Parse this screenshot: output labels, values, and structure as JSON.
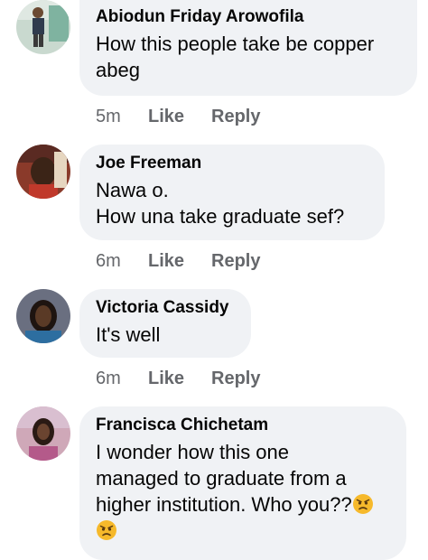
{
  "comments": [
    {
      "author": "Abiodun Friday Arowofila",
      "text": "How this people take be copper\nabeg",
      "time": "5m",
      "like_label": "Like",
      "reply_label": "Reply"
    },
    {
      "author": "Joe Freeman",
      "text": "Nawa o.\nHow una take graduate sef?",
      "time": "6m",
      "like_label": "Like",
      "reply_label": "Reply"
    },
    {
      "author": "Victoria Cassidy",
      "text": "It's well",
      "time": "6m",
      "like_label": "Like",
      "reply_label": "Reply"
    },
    {
      "author": "Francisca Chichetam",
      "text": "I wonder how this one\nmanaged to graduate from a\nhigher institution. Who you??",
      "emoji": "pouting-face-icon"
    }
  ],
  "colors": {
    "bubble_bg": "#f0f2f5",
    "meta_text": "#65676b",
    "name_text": "#050505"
  }
}
